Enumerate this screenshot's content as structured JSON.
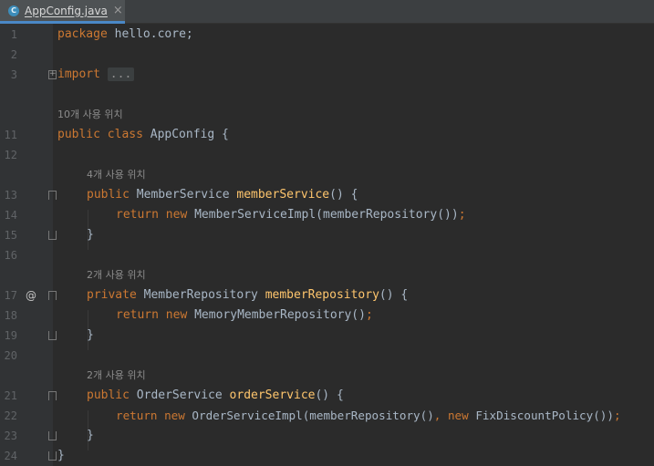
{
  "tab": {
    "title": "AppConfig.java",
    "icon_letter": "C",
    "close": "×"
  },
  "lines": [
    {
      "n": "1"
    },
    {
      "n": "2"
    },
    {
      "n": "3"
    },
    {
      "n": "11"
    },
    {
      "n": "12"
    },
    {
      "n": "13"
    },
    {
      "n": "14"
    },
    {
      "n": "15"
    },
    {
      "n": "16"
    },
    {
      "n": "17"
    },
    {
      "n": "18"
    },
    {
      "n": "19"
    },
    {
      "n": "20"
    },
    {
      "n": "21"
    },
    {
      "n": "22"
    },
    {
      "n": "23"
    },
    {
      "n": "24"
    }
  ],
  "code": {
    "l1_kw": "package",
    "l1_rest": " hello.core;",
    "l3_kw": "import",
    "l3_dots": "...",
    "hint_class": "10개 사용 위치",
    "l11_kw": "public class",
    "l11_rest": " AppConfig {",
    "hint_ms": "4개 사용 위치",
    "l13_kw": "public",
    "l13_type": " MemberService ",
    "l13_fn": "memberService",
    "l13_rest": "() {",
    "l14_kw": "return new",
    "l14_rest": " MemberServiceImpl(memberRepository())",
    "l14_semi": ";",
    "l15": "}",
    "hint_mr": "2개 사용 위치",
    "l17_kw": "private",
    "l17_type": " MemberRepository ",
    "l17_fn": "memberRepository",
    "l17_rest": "() {",
    "l17_mark": "@",
    "l18_kw": "return new",
    "l18_rest": " MemoryMemberRepository()",
    "l18_semi": ";",
    "l19": "}",
    "hint_os": "2개 사용 위치",
    "l21_kw": "public",
    "l21_type": " OrderService ",
    "l21_fn": "orderService",
    "l21_rest": "() {",
    "l22_kw": "return new",
    "l22_mid": " OrderServiceImpl(memberRepository()",
    "l22_comma": ",",
    "l22_kw2": " new",
    "l22_rest": " FixDiscountPolicy())",
    "l22_semi": ";",
    "l23": "}",
    "l24": "}"
  },
  "colors": {
    "keyword": "#cc7832",
    "method": "#ffc66d",
    "text": "#a9b7c6",
    "hint": "#8c8c8c",
    "background": "#2b2b2b"
  }
}
